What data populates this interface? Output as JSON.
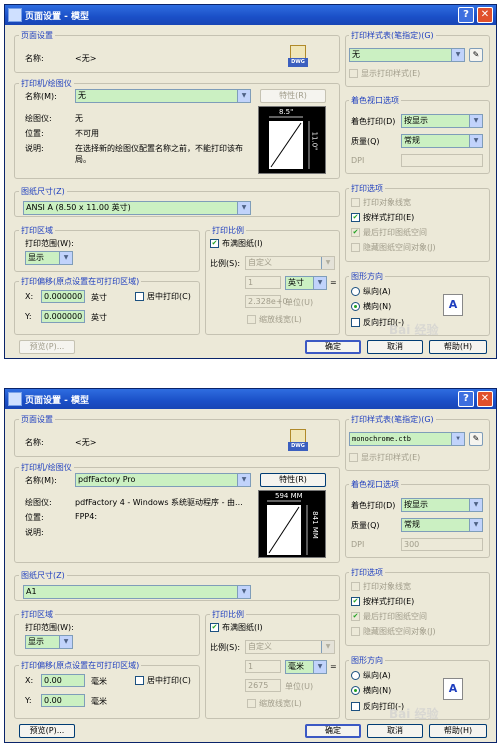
{
  "dialogs": [
    {
      "title": "页面设置 - 模型",
      "help_icon": "?",
      "close_icon": "✕",
      "page_setup": {
        "group": "页面设置",
        "name_label": "名称:",
        "name_value": "<无>",
        "dwg_icon": "DWG"
      },
      "printer": {
        "group": "打印机/绘图仪",
        "name_label": "名称(M):",
        "combo": "无",
        "props_btn": "特性(R)",
        "plotter_label": "绘图仪:",
        "plotter_value": "无",
        "location_label": "位置:",
        "location_value": "不可用",
        "desc_label": "说明:",
        "desc_value_1": "在选择新的绘图仪配置名称之前，不能打印该布",
        "desc_value_2": "局。",
        "preview_w": "8.5\"",
        "preview_h": "11.0\""
      },
      "paper": {
        "group": "图纸尺寸(Z)",
        "value": "ANSI A (8.50 x 11.00 英寸)"
      },
      "area": {
        "group": "打印区域",
        "range_label": "打印范围(W):",
        "range_value": "显示"
      },
      "offset": {
        "group": "打印偏移(原点设置在可打印区域)",
        "x_label": "X:",
        "x_value": "0.000000",
        "x_unit": "英寸",
        "y_label": "Y:",
        "y_value": "0.000000",
        "y_unit": "英寸",
        "center": "居中打印(C)"
      },
      "scale": {
        "group": "打印比例",
        "fit": "布满图纸(I)",
        "ratio_label": "比例(S):",
        "ratio_value": "自定义",
        "v1": "1",
        "unit": "英寸",
        "eq": "=",
        "v2": "2.328e+0",
        "unit2": "单位(U)",
        "lineweight": "缩放线宽(L)"
      },
      "preview_btn": "预览(P)...",
      "style": {
        "group": "打印样式表(笔指定)(G)",
        "value": "无",
        "show": "显示打印样式(E)",
        "edit_icon": "pencil-icon"
      },
      "shade": {
        "group": "着色视口选项",
        "shade_label": "着色打印(D)",
        "shade_value": "按显示",
        "quality_label": "质量(Q)",
        "quality_value": "常规",
        "dpi_label": "DPI",
        "dpi_value": ""
      },
      "options": {
        "group": "打印选项",
        "o1": "打印对象线宽",
        "o2": "按样式打印(E)",
        "o3": "最后打印图纸空间",
        "o4": "隐藏图纸空间对象(J)"
      },
      "orientation": {
        "group": "图形方向",
        "portrait": "纵向(A)",
        "landscape": "横向(N)",
        "reverse": "反向打印(-)",
        "icon": "A"
      },
      "buttons": {
        "ok": "确定",
        "cancel": "取消",
        "help": "帮助(H)"
      }
    },
    {
      "title": "页面设置 - 模型",
      "help_icon": "?",
      "close_icon": "✕",
      "page_setup": {
        "group": "页面设置",
        "name_label": "名称:",
        "name_value": "<无>",
        "dwg_icon": "DWG"
      },
      "printer": {
        "group": "打印机/绘图仪",
        "name_label": "名称(M):",
        "combo": "pdfFactory Pro",
        "props_btn": "特性(R)",
        "plotter_label": "绘图仪:",
        "plotter_value": "pdfFactory 4 - Windows 系统驱动程序 - 由...",
        "location_label": "位置:",
        "location_value": "FPP4:",
        "desc_label": "说明:",
        "desc_value_1": "",
        "desc_value_2": "",
        "preview_w": "594 MM",
        "preview_h": "841 MM"
      },
      "paper": {
        "group": "图纸尺寸(Z)",
        "value": "A1"
      },
      "area": {
        "group": "打印区域",
        "range_label": "打印范围(W):",
        "range_value": "显示"
      },
      "offset": {
        "group": "打印偏移(原点设置在可打印区域)",
        "x_label": "X:",
        "x_value": "0.00",
        "x_unit": "毫米",
        "y_label": "Y:",
        "y_value": "0.00",
        "y_unit": "毫米",
        "center": "居中打印(C)"
      },
      "scale": {
        "group": "打印比例",
        "fit": "布满图纸(I)",
        "ratio_label": "比例(S):",
        "ratio_value": "自定义",
        "v1": "1",
        "unit": "毫米",
        "eq": "=",
        "v2": "2675",
        "unit2": "单位(U)",
        "lineweight": "缩放线宽(L)"
      },
      "preview_btn": "预览(P)...",
      "style": {
        "group": "打印样式表(笔指定)(G)",
        "value": "monochrome.ctb",
        "show": "显示打印样式(E)",
        "edit_icon": "pencil-icon"
      },
      "shade": {
        "group": "着色视口选项",
        "shade_label": "着色打印(D)",
        "shade_value": "按显示",
        "quality_label": "质量(Q)",
        "quality_value": "常规",
        "dpi_label": "DPI",
        "dpi_value": "300"
      },
      "options": {
        "group": "打印选项",
        "o1": "打印对象线宽",
        "o2": "按样式打印(E)",
        "o3": "最后打印图纸空间",
        "o4": "隐藏图纸空间对象(J)"
      },
      "orientation": {
        "group": "图形方向",
        "portrait": "纵向(A)",
        "landscape": "横向(N)",
        "reverse": "反向打印(-)",
        "icon": "A"
      },
      "buttons": {
        "ok": "确定",
        "cancel": "取消",
        "help": "帮助(H)"
      }
    }
  ],
  "watermark": "Bai 经验",
  "colors": {
    "title_bar": "#1a4fc7",
    "field_green": "#cbf0c2",
    "group_label": "#1f3fbf",
    "dialog_bg": "#ece9d8"
  }
}
